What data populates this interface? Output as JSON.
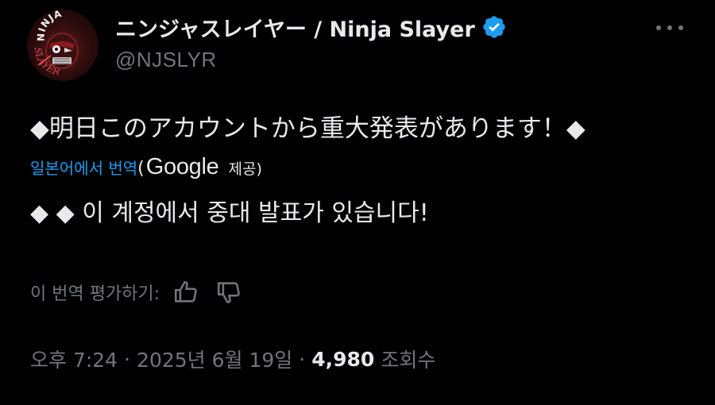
{
  "tweet": {
    "avatar_text_top": "NINJA",
    "avatar_text_bottom": "SLAYER",
    "display_name": "ニンジャスレイヤー / Ninja Slayer",
    "handle": "@NJSLYR",
    "verified": true,
    "accent_color": "#1d9bf0",
    "original_text": "◆明日このアカウントから重大発表があります！◆",
    "translated_link": "일본어에서 번역",
    "translated_paren_open": "(",
    "translated_provider": "Google",
    "translated_provide_label": "제공)",
    "translation_text": "◆ ◆ 이 계정에서 중대 발표가 있습니다!",
    "rate_label": "이 번역 평가하기:",
    "rate_up_icon": "thumbs-up-icon",
    "rate_down_icon": "thumbs-down-icon",
    "time": "오후 7:24",
    "separator": "·",
    "date": "2025년 6월 19일",
    "views_count": "4,980",
    "views_label": "조회수"
  }
}
